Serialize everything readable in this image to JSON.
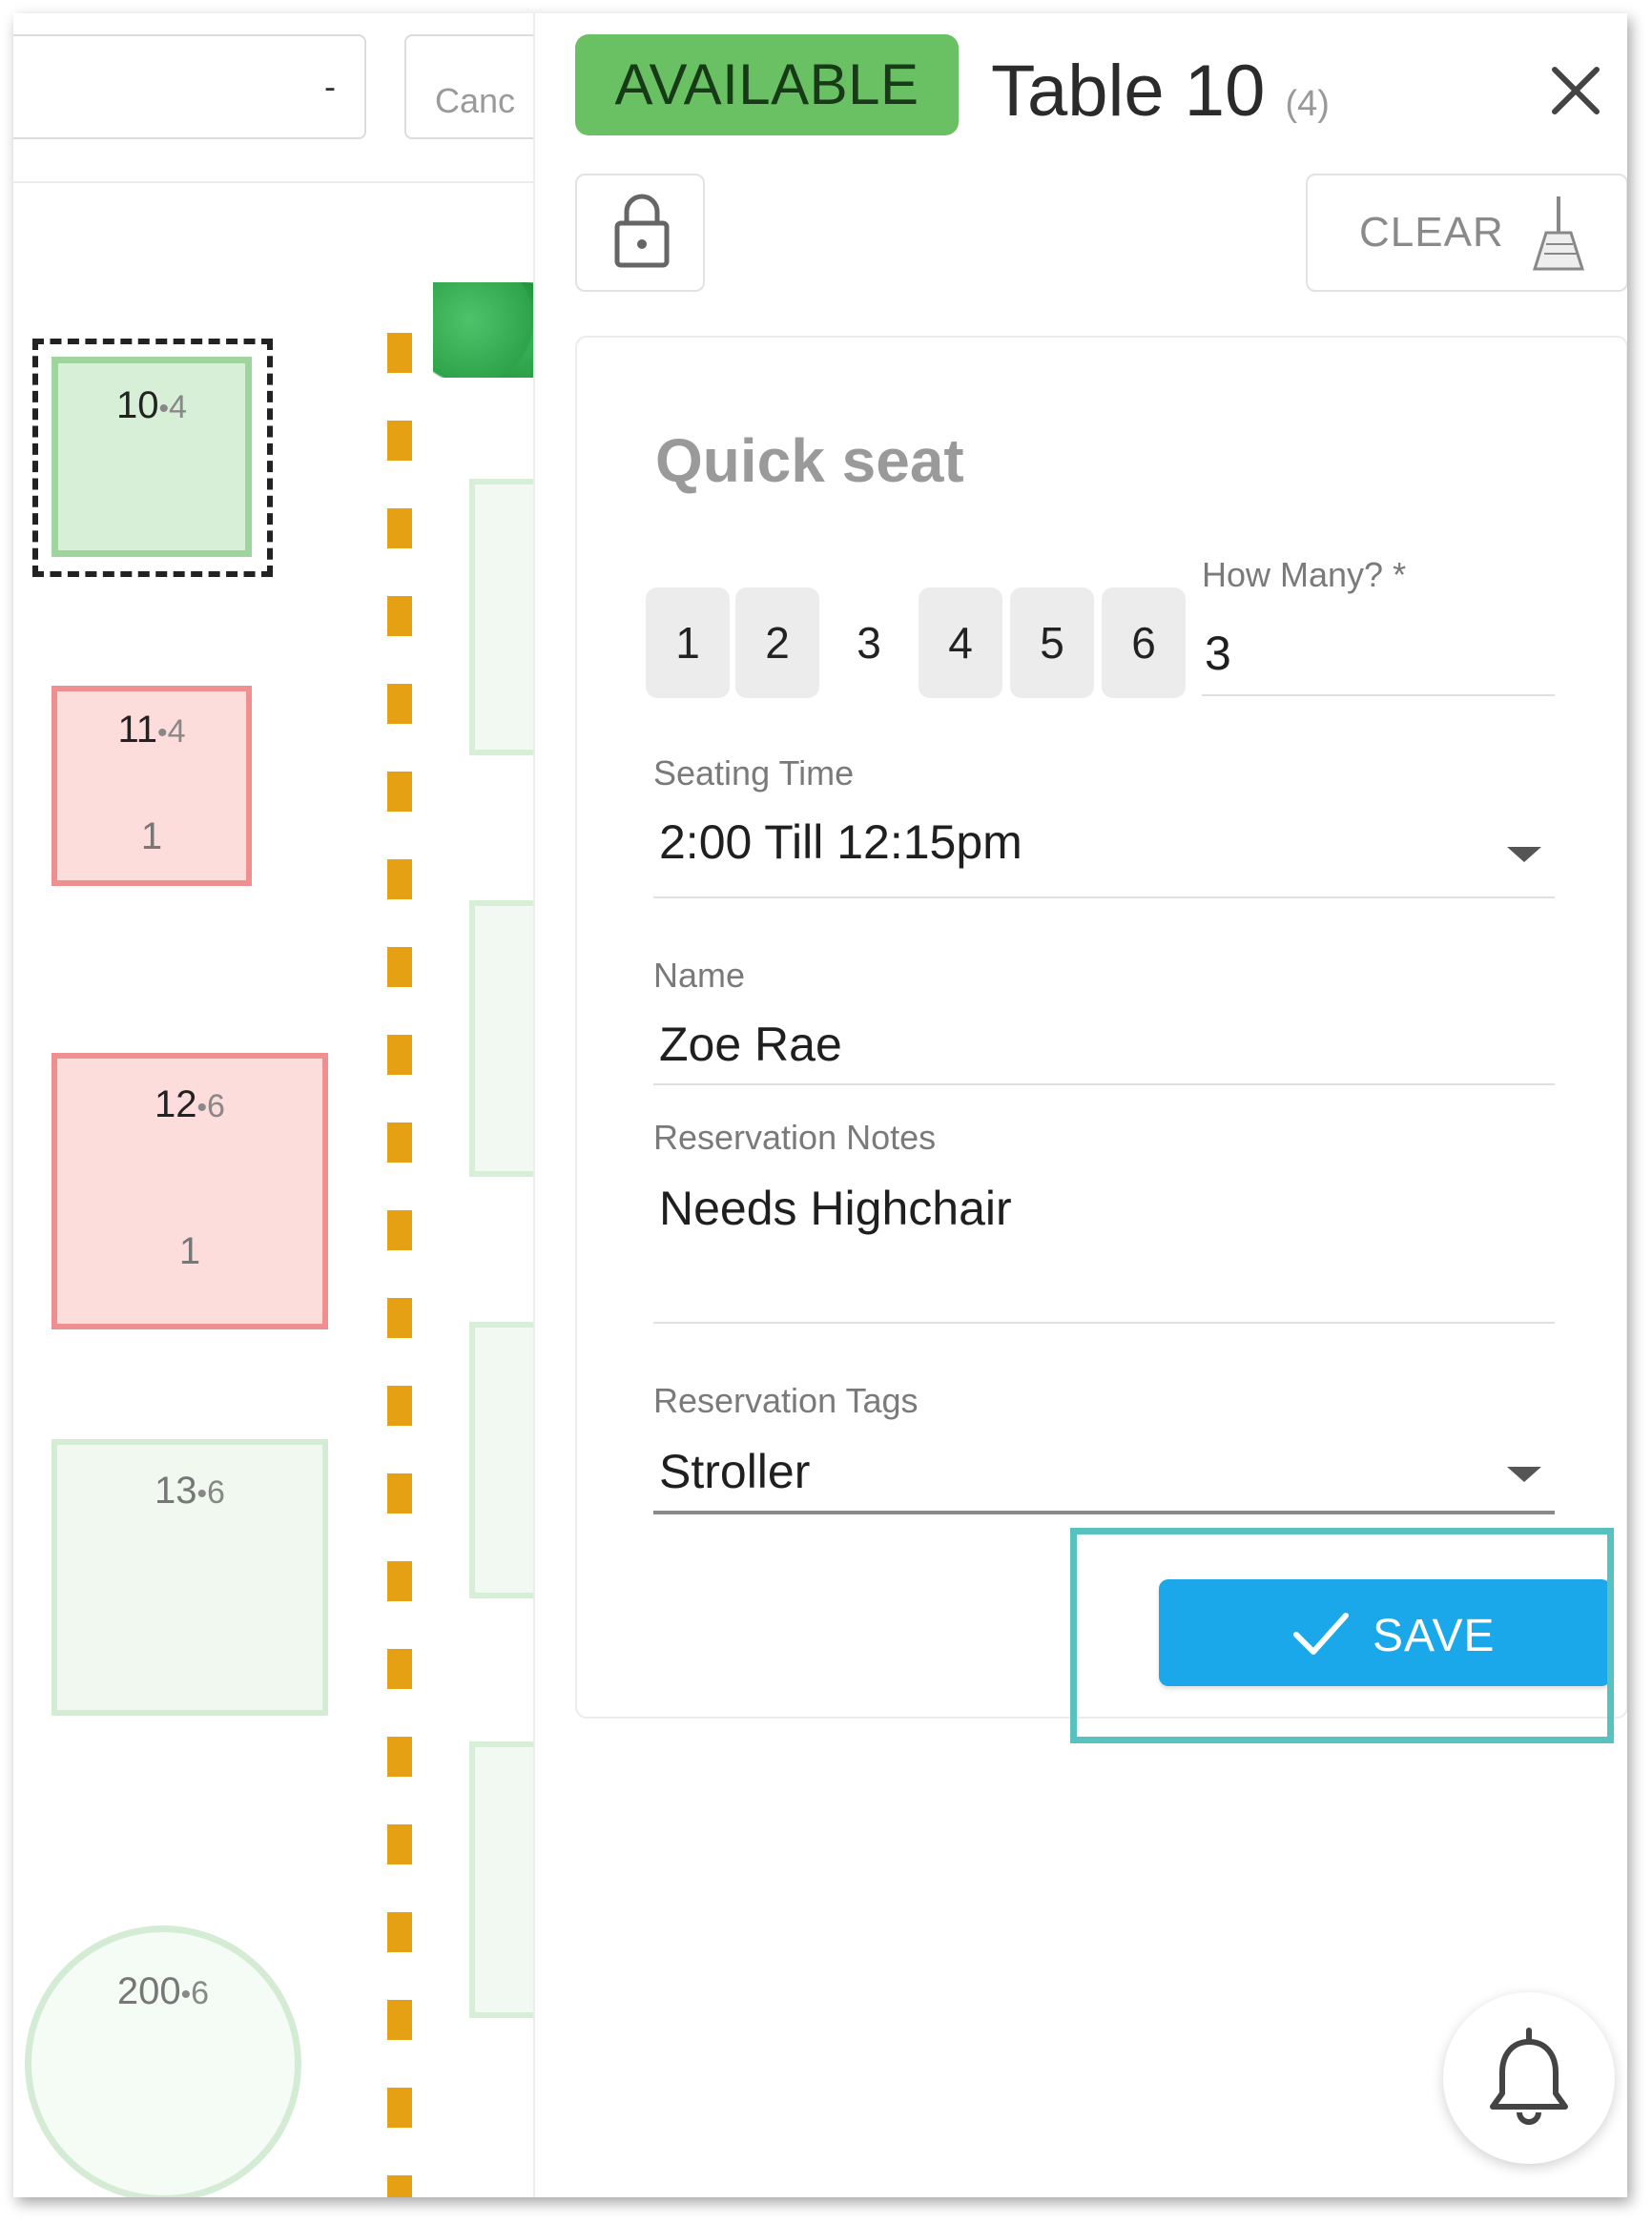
{
  "floor": {
    "top_select_value": "-",
    "cancel_label": "Canc",
    "tables": [
      {
        "number": "10",
        "capacity": "4",
        "separator": "•",
        "guests": ""
      },
      {
        "number": "11",
        "capacity": "4",
        "separator": "•",
        "guests": "1"
      },
      {
        "number": "12",
        "capacity": "6",
        "separator": "•",
        "guests": "1"
      },
      {
        "number": "13",
        "capacity": "6",
        "separator": "•",
        "guests": ""
      },
      {
        "number": "200",
        "capacity": "6",
        "separator": "•",
        "guests": ""
      }
    ]
  },
  "panel": {
    "status": "AVAILABLE",
    "title": "Table 10",
    "title_capacity": "(4)",
    "clear_label": "CLEAR",
    "card_title": "Quick seat",
    "party_sizes": [
      "1",
      "2",
      "3",
      "4",
      "5",
      "6"
    ],
    "selected_party_size": "3",
    "how_many_label": "How Many? *",
    "how_many_value": "3",
    "seating_time_label": "Seating Time",
    "seating_time_value": "2:00 Till 12:15pm",
    "name_label": "Name",
    "name_value": "Zoe Rae",
    "notes_label": "Reservation Notes",
    "notes_value": "Needs Highchair",
    "tags_label": "Reservation Tags",
    "tags_value": "Stroller",
    "save_label": "SAVE"
  },
  "colors": {
    "available": "#69c164",
    "save": "#1aa8ea",
    "highlight": "#57c2c0",
    "occupied_fill": "#fddcdc",
    "occupied_border": "#f08f8f",
    "free_fill": "#d6efd6",
    "divider": "#e6a014"
  },
  "icons": {
    "close": "close-icon",
    "lock": "lock-icon",
    "clear": "broom-icon",
    "save": "check-icon",
    "seating_time": "chevron-down-icon",
    "tags": "chevron-down-icon",
    "notifications": "bell-icon"
  }
}
